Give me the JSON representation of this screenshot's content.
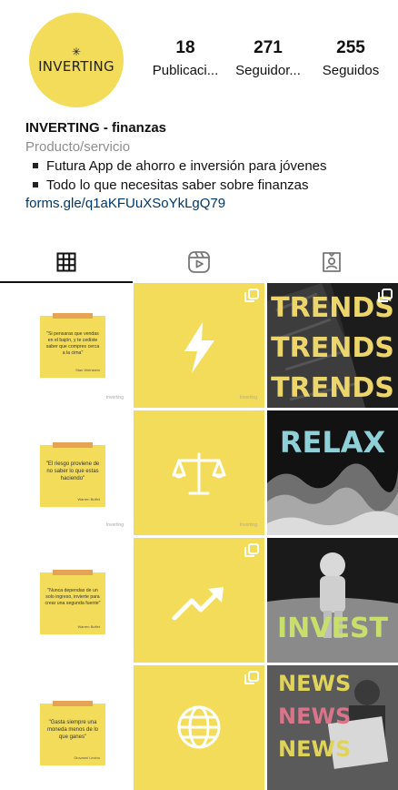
{
  "profile": {
    "avatar_text": "INVERTING",
    "stats": [
      {
        "num": "18",
        "label": "Publicaci..."
      },
      {
        "num": "271",
        "label": "Seguidor..."
      },
      {
        "num": "255",
        "label": "Seguidos"
      }
    ],
    "name": "INVERTING - finanzas",
    "category": "Producto/servicio",
    "bio_lines": [
      "Futura App de ahorro e inversión para jóvenes",
      "Todo lo que necesitas saber sobre finanzas"
    ],
    "link": "forms.gle/q1aKFUuXSoYkLgQ79"
  },
  "tabs": [
    {
      "icon": "grid-icon",
      "active": true
    },
    {
      "icon": "reels-icon",
      "active": false
    },
    {
      "icon": "tagged-icon",
      "active": false
    }
  ],
  "posts": {
    "quotes": [
      {
        "text": "\"Si pensaras que vendas en el bajón, y te cediste saber que compres cerca a la cima\"",
        "author": "Stan Weinstein"
      },
      {
        "text": "\"El riesgo proviene de no saber lo que estas haciendo\"",
        "author": "Warren Buffet"
      },
      {
        "text": "\"Nunca dependas de un solo ingreso, invierte para crear una segunda fuente\"",
        "author": "Warren Buffet"
      },
      {
        "text": "\"Gasta siempre una moneda menos de lo que ganes\"",
        "author": "Giovanni Lecino"
      }
    ],
    "brand": "Inverting",
    "words": {
      "trends": [
        "TRENDS",
        "TRENDS",
        "TRENDS"
      ],
      "relax": "RELAX",
      "invest": "INVEST",
      "news": [
        "NEWS",
        "NEWS",
        "NEWS"
      ]
    },
    "icons": [
      "lightning-icon",
      "scales-icon",
      "trending-up-icon",
      "globe-icon"
    ]
  },
  "colors": {
    "accent_yellow": "#f3dc5a",
    "tape_orange": "#e6a255",
    "link_blue": "#00376b"
  }
}
